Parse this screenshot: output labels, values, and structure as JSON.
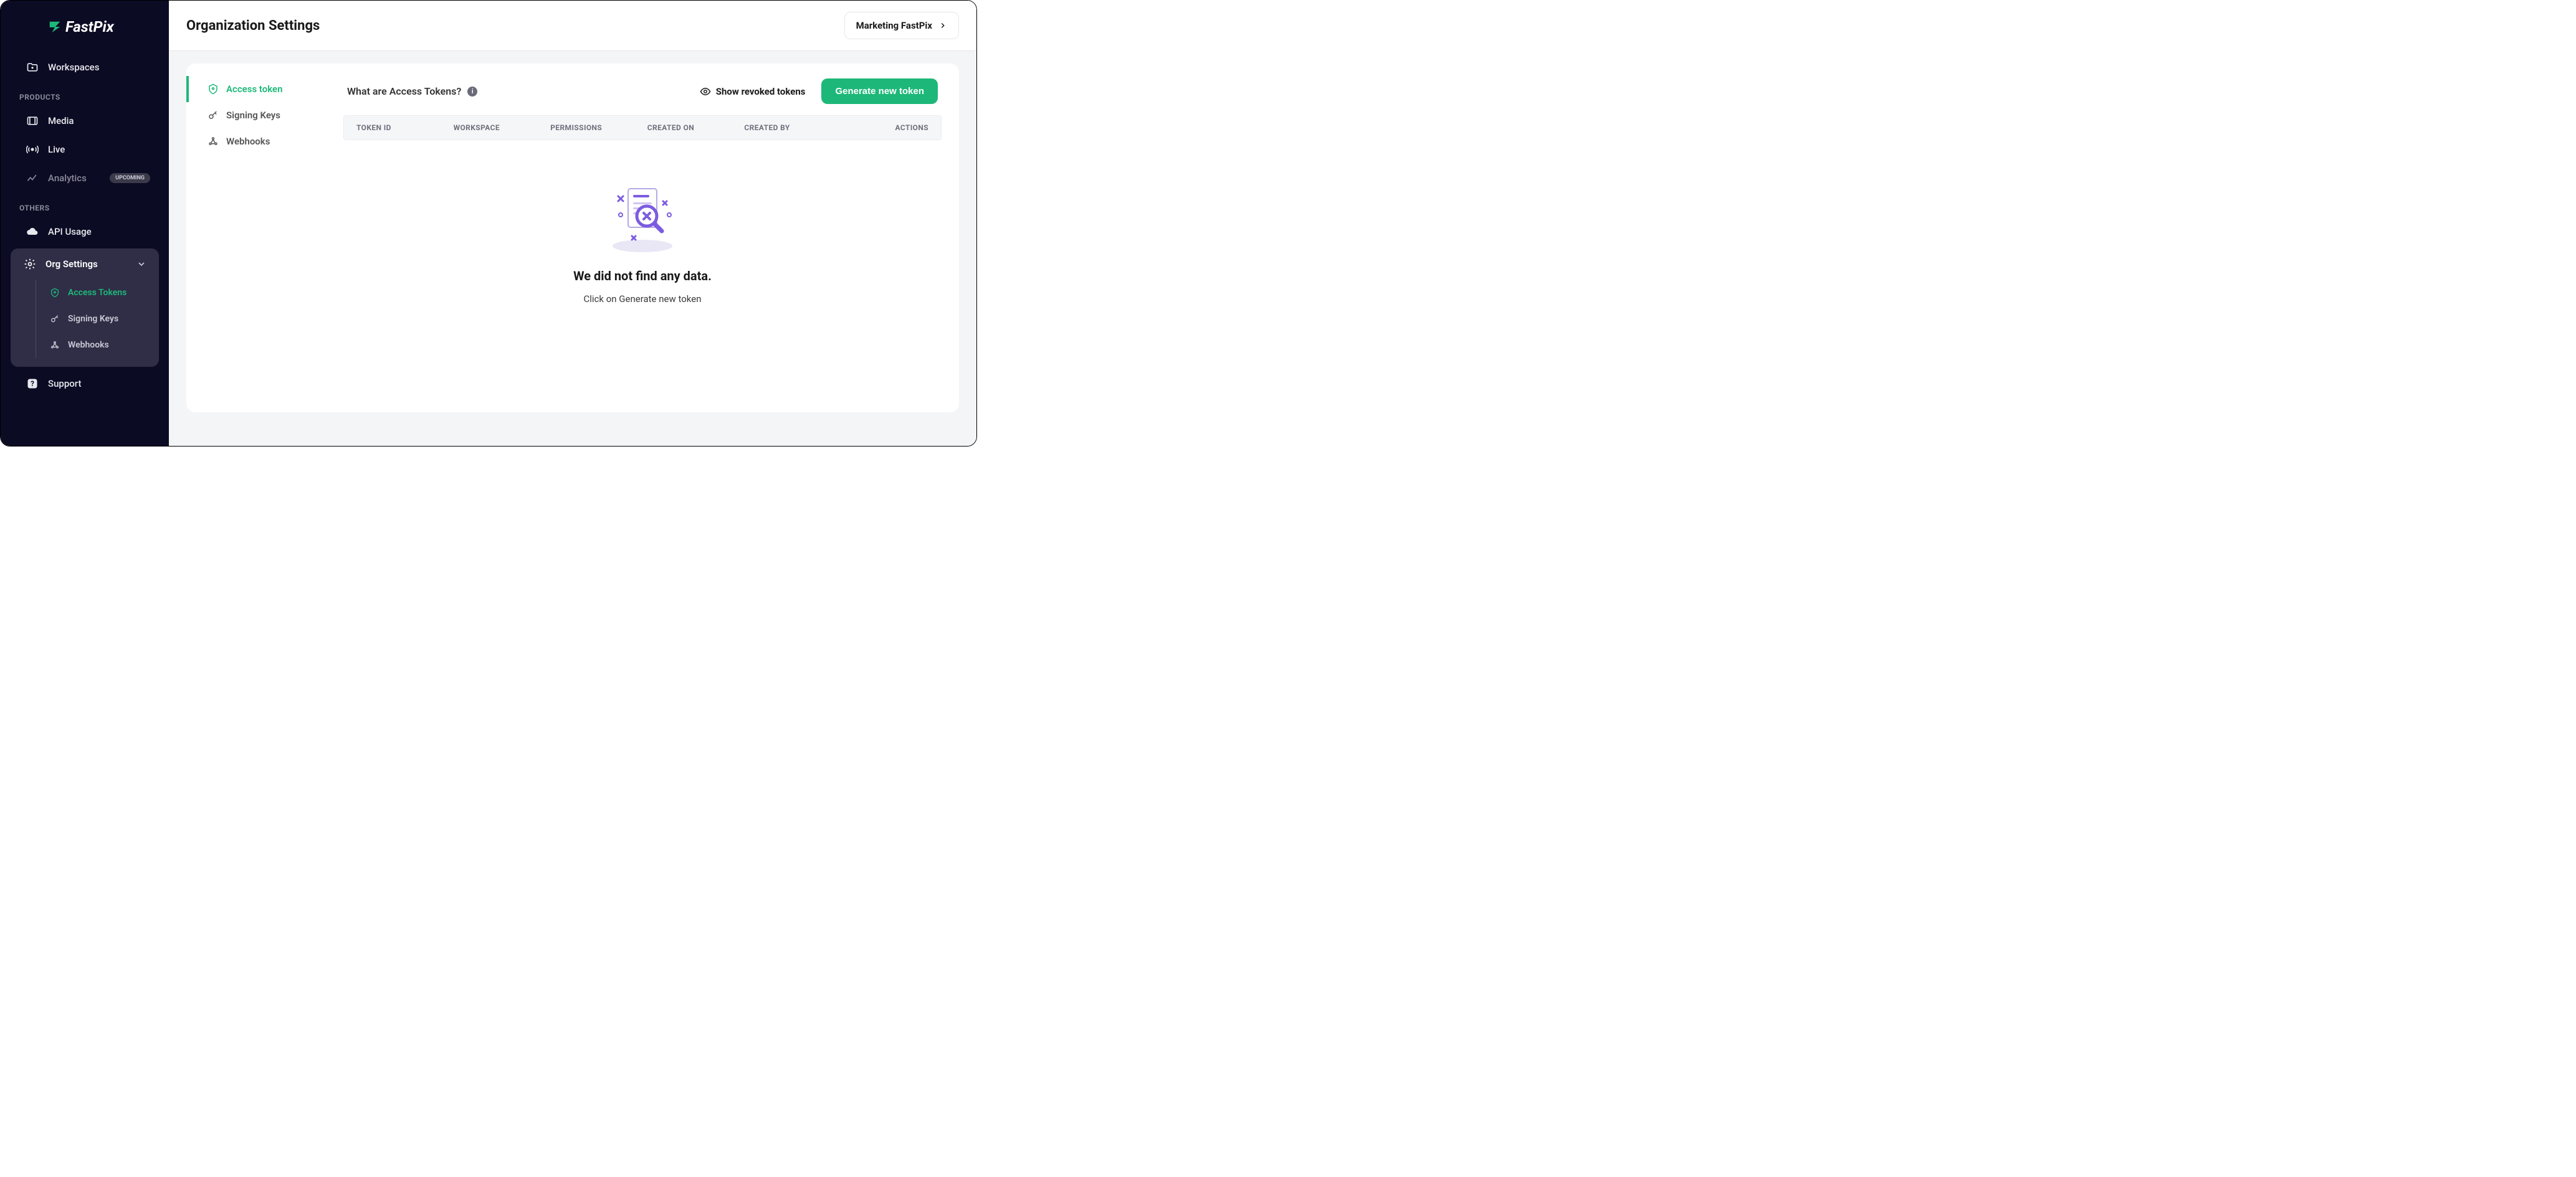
{
  "brand": {
    "name": "FastPix"
  },
  "sidebar": {
    "workspaces": "Workspaces",
    "section_products": "PRODUCTS",
    "media": "Media",
    "live": "Live",
    "analytics": "Analytics",
    "analytics_badge": "UPCOMING",
    "section_others": "OTHERS",
    "api_usage": "API Usage",
    "org_settings": "Org Settings",
    "sub_access_tokens": "Access Tokens",
    "sub_signing_keys": "Signing Keys",
    "sub_webhooks": "Webhooks",
    "support": "Support"
  },
  "header": {
    "title": "Organization Settings",
    "org_name": "Marketing FastPix"
  },
  "tabs": {
    "access_token": "Access token",
    "signing_keys": "Signing Keys",
    "webhooks": "Webhooks"
  },
  "body": {
    "info_text": "What are Access Tokens?",
    "show_revoked": "Show revoked tokens",
    "generate_btn": "Generate new token"
  },
  "table": {
    "columns": [
      "TOKEN ID",
      "WORKSPACE",
      "PERMISSIONS",
      "CREATED ON",
      "CREATED BY",
      "ACTIONS"
    ]
  },
  "empty": {
    "title": "We did not find any data.",
    "subtitle": "Click on Generate new token"
  }
}
